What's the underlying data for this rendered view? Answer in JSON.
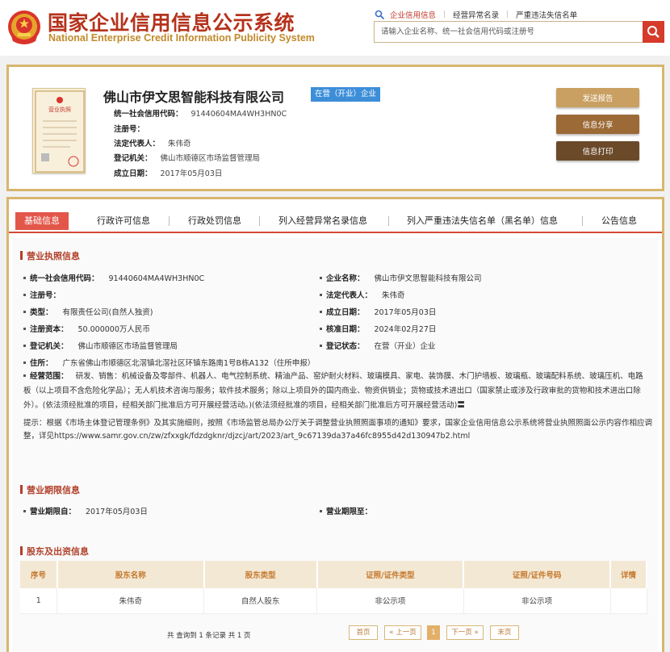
{
  "header": {
    "title_cn": "国家企业信用信息公示系统",
    "title_en": "National Enterprise Credit Information Publicity System",
    "nav": [
      "企业信用信息",
      "经营异常名录",
      "严重违法失信名单"
    ],
    "search_placeholder": "请输入企业名称、统一社会信用代码或注册号",
    "icons": {
      "search": "search-icon",
      "magnifier": "magnifier-icon",
      "emblem": "national-emblem-icon"
    },
    "colors": {
      "brand_red": "#b5331d",
      "gold": "#c08a2a",
      "search_red": "#d53a2a"
    }
  },
  "company": {
    "name": "佛山市伊文思智能科技有限公司",
    "status_badge": "在营（开业）企业",
    "fields": [
      {
        "label": "统一社会信用代码：",
        "value": "91440604MA4WH3HN0C"
      },
      {
        "label": "注册号：",
        "value": ""
      },
      {
        "label": "法定代表人：",
        "value": "朱伟奇"
      },
      {
        "label": "登记机关：",
        "value": "佛山市顺德区市场监督管理局"
      },
      {
        "label": "成立日期：",
        "value": "2017年05月03日"
      }
    ],
    "buttons": [
      "发送报告",
      "信息分享",
      "信息打印"
    ],
    "license_thumb_label": "营业执照"
  },
  "tabs": [
    "基础信息",
    "行政许可信息",
    "行政处罚信息",
    "列入经营异常名录信息",
    "列入严重违法失信名单（黑名单）信息",
    "公告信息"
  ],
  "business_license": {
    "title": "营业执照信息",
    "left": [
      {
        "label": "统一社会信用代码：",
        "value": "91440604MA4WH3HN0C"
      },
      {
        "label": "注册号：",
        "value": ""
      },
      {
        "label": "类型：",
        "value": "有限责任公司(自然人独资)"
      },
      {
        "label": "注册资本：",
        "value": "50.000000万人民币"
      },
      {
        "label": "登记机关：",
        "value": "佛山市顺德区市场监督管理局"
      }
    ],
    "right": [
      {
        "label": "企业名称：",
        "value": "佛山市伊文思智能科技有限公司"
      },
      {
        "label": "法定代表人：",
        "value": "朱伟奇"
      },
      {
        "label": "成立日期：",
        "value": "2017年05月03日"
      },
      {
        "label": "核准日期：",
        "value": "2024年02月27日"
      },
      {
        "label": "登记状态：",
        "value": "在营（开业）企业"
      }
    ],
    "address_label": "住所：",
    "address": "广东省佛山市顺德区北滘镇北滘社区环镇东路南1号B栋A132（住所申报）",
    "scope_label": "经营范围：",
    "scope": "研发、销售：机械设备及零部件、机器人、电气控制系统、精油产品、窑炉耐火材料、玻璃模具、家电、装饰膜、木门护墙板、玻璃瓶、玻璃配料系统、玻璃压机、电路板（以上项目不含危险化学品）；无人机技术咨询与服务；软件技术服务；除以上项目外的国内商业、物资供销业；货物或技术进出口（国家禁止或涉及行政审批的货物和技术进出口除外）。(依法须经批准的项目，经相关部门批准后方可开展经营活动。)(依法须经批准的项目，经相关部门批准后方可开展经营活动)〓",
    "notice": "提示：根据《市场主体登记管理条例》及其实施细则，按照《市场监管总局办公厅关于调整营业执照照面事项的通知》要求，国家企业信用信息公示系统将营业执照照面公示内容作相应调整，详见https://www.samr.gov.cn/zw/zfxxgk/fdzdgknr/djzcj/art/2023/art_9c67139da37a46fc8955d42d130947b2.html"
  },
  "business_term": {
    "title": "营业期限信息",
    "from_label": "营业期限自：",
    "from": "2017年05月03日",
    "to_label": "营业期限至：",
    "to": ""
  },
  "shareholders": {
    "title": "股东及出资信息",
    "columns": [
      "序号",
      "股东名称",
      "股东类型",
      "证照/证件类型",
      "证照/证件号码",
      "详情"
    ],
    "rows": [
      [
        "1",
        "朱伟奇",
        "自然人股东",
        "非公示项",
        "非公示项",
        ""
      ]
    ],
    "pager": {
      "info": "共 查询到 1 条记录 共 1 页",
      "first": "首页",
      "prev": "« 上一页",
      "current": "1",
      "next": "下一页 »",
      "last": "末页"
    }
  }
}
